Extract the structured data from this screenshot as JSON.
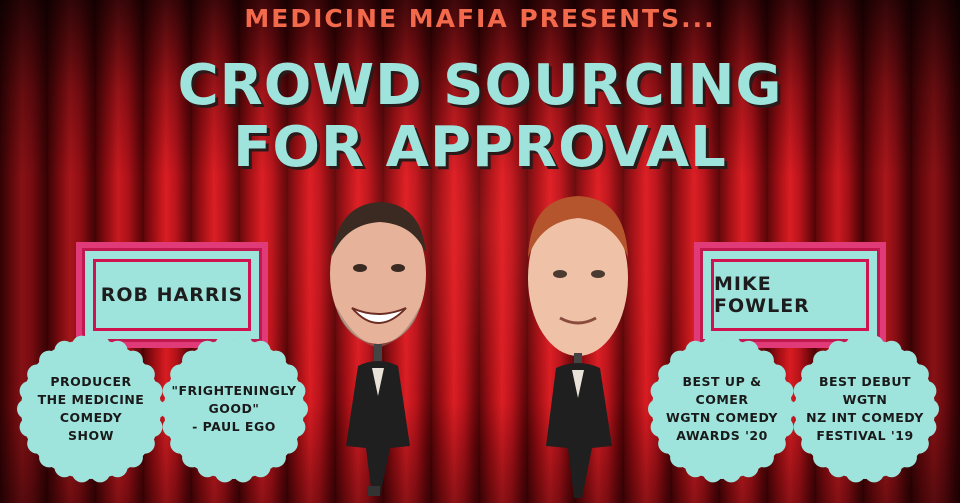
{
  "presents": "MEDICINE MAFIA PRESENTS...",
  "title_line1": "CROWD SOURCING",
  "title_line2": "FOR APPROVAL",
  "comedians": [
    {
      "name": "ROB HARRIS",
      "badges": [
        "PRODUCER\nTHE MEDICINE\nCOMEDY\nSHOW",
        "\"FRIGHTENINGLY\nGOOD\"\n- PAUL EGO"
      ]
    },
    {
      "name": "MIKE FOWLER",
      "badges": [
        "BEST UP &\nCOMER\nWGTN COMEDY\nAWARDS '20",
        "BEST DEBUT\nWGTN\nNZ INT COMEDY\nFESTIVAL '19"
      ]
    }
  ],
  "colors": {
    "accent": "#9fe4dc",
    "pink": "#e03a78",
    "orange": "#f26a4b",
    "curtain": "#c8161c"
  }
}
